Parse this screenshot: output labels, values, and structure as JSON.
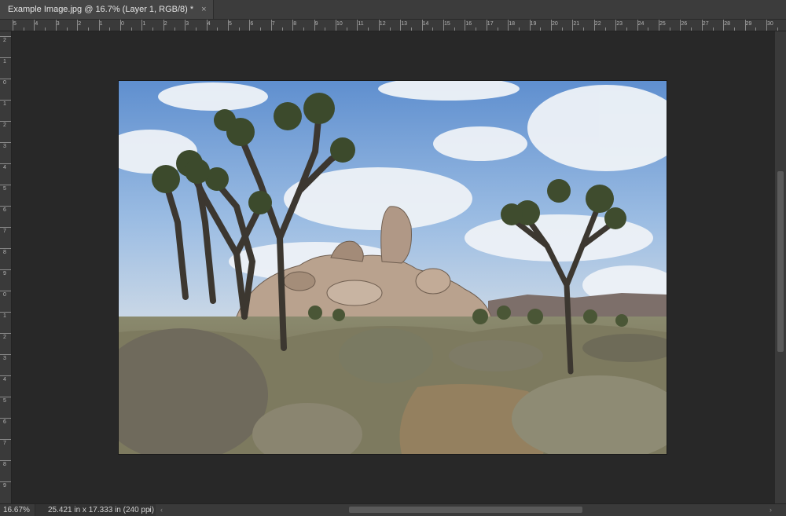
{
  "tab": {
    "title": "Example Image.jpg @ 16.7% (Layer 1, RGB/8) *",
    "close_glyph": "×"
  },
  "rulers": {
    "horizontal_labels": [
      "5",
      "4",
      "3",
      "2",
      "1",
      "0",
      "1",
      "2",
      "3",
      "4",
      "5",
      "6",
      "7",
      "8",
      "9",
      "10",
      "11",
      "12",
      "13",
      "14",
      "15",
      "16",
      "17",
      "18",
      "19",
      "20",
      "21",
      "22",
      "23",
      "24",
      "25",
      "26",
      "27",
      "28",
      "29",
      "30"
    ],
    "vertical_labels": [
      "2",
      "1",
      "0",
      "1",
      "2",
      "3",
      "4",
      "5",
      "6",
      "7",
      "8",
      "9",
      "0",
      "1",
      "2",
      "3",
      "4",
      "5",
      "6",
      "7",
      "8",
      "9",
      "2"
    ]
  },
  "status": {
    "zoom": "16.67%",
    "doc_info": "25.421 in x 17.333 in (240 ppi)",
    "arrow_glyph": "›",
    "scroll_left_glyph": "‹",
    "scroll_right_glyph": "›"
  },
  "colors": {
    "workspace": "#282828",
    "panel": "#3a3a3a",
    "tab": "#454545",
    "sky": "#7fa6d9",
    "cloud": "#eef2f7",
    "rock": "#b8a08c",
    "ground": "#8c7a62"
  }
}
